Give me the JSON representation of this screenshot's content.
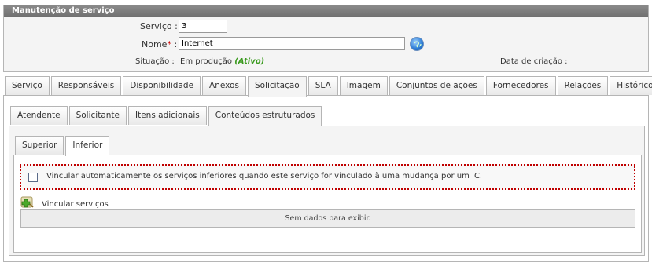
{
  "panel": {
    "title": "Manutenção de serviço"
  },
  "form": {
    "servico_label": "Serviço :",
    "servico_value": "3",
    "nome_label": "Nome",
    "nome_required": "*",
    "nome_colon": ":",
    "nome_value": "Internet",
    "situacao_label": "Situação :",
    "situacao_value": "Em produção",
    "situacao_status": "(Ativo)",
    "data_criacao_label": "Data de criação :"
  },
  "main_tabs": [
    {
      "label": "Serviço"
    },
    {
      "label": "Responsáveis"
    },
    {
      "label": "Disponibilidade"
    },
    {
      "label": "Anexos"
    },
    {
      "label": "Solicitação"
    },
    {
      "label": "SLA"
    },
    {
      "label": "Imagem"
    },
    {
      "label": "Conjuntos de ações"
    },
    {
      "label": "Fornecedores"
    },
    {
      "label": "Relações"
    },
    {
      "label": "Histórico"
    }
  ],
  "main_tabs_active": "Solicitação",
  "sub_tabs": [
    {
      "label": "Atendente"
    },
    {
      "label": "Solicitante"
    },
    {
      "label": "Itens adicionais"
    },
    {
      "label": "Conteúdos estruturados"
    }
  ],
  "sub_tabs_active": "Conteúdos estruturados",
  "inner_tabs": [
    {
      "label": "Superior"
    },
    {
      "label": "Inferior"
    }
  ],
  "inner_tabs_active": "Inferior",
  "auto_link_checkbox": {
    "label": "Vincular automaticamente os serviços inferiores quando este serviço for vinculado à uma mudança por um IC.",
    "checked": false
  },
  "link_services": {
    "label": "Vincular serviços",
    "icon": "add-link-icon"
  },
  "grid": {
    "empty_text": "Sem dados para exibir."
  },
  "colors": {
    "header_bg": "#7a7a7a",
    "status_green": "#3a9a1e",
    "required_red": "#d00000",
    "highlight_border": "#c00000"
  }
}
